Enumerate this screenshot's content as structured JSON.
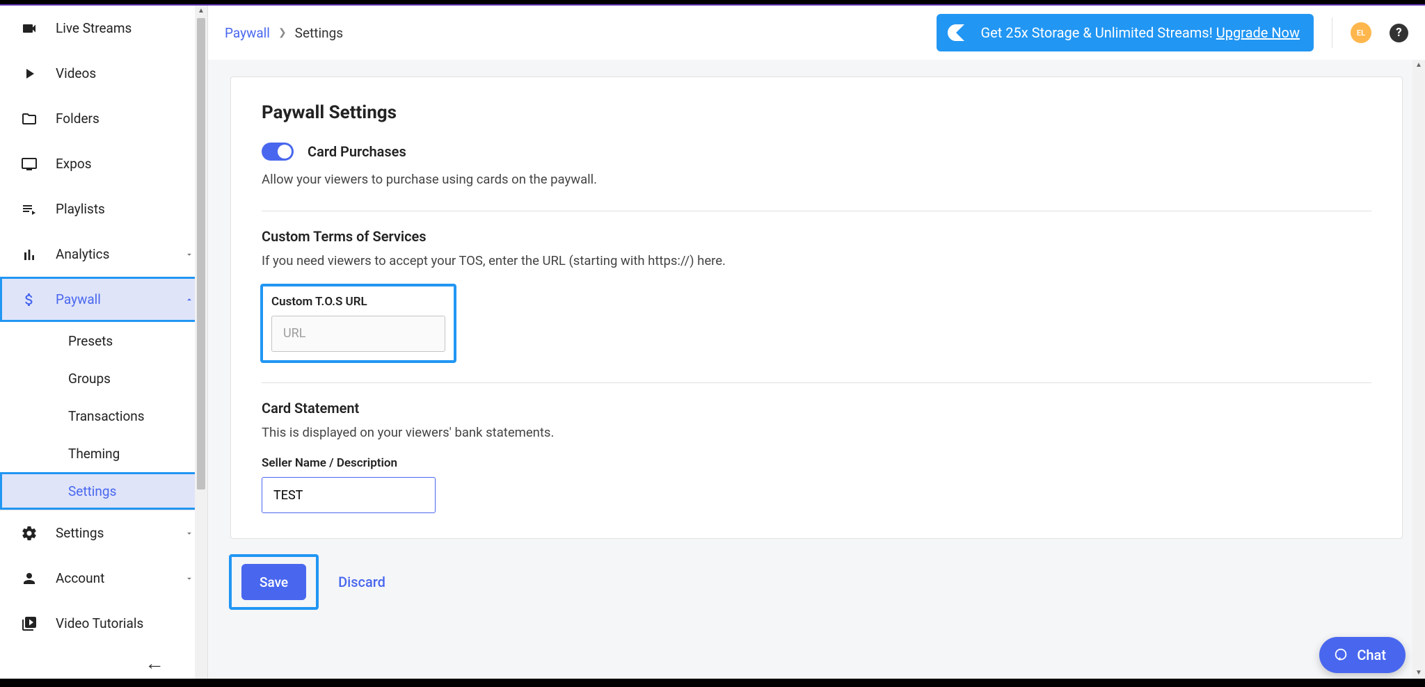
{
  "sidebar": {
    "items": {
      "liveStreams": "Live Streams",
      "videos": "Videos",
      "folders": "Folders",
      "expos": "Expos",
      "playlists": "Playlists",
      "analytics": "Analytics",
      "paywall": "Paywall",
      "settings": "Settings",
      "account": "Account",
      "videoTutorials": "Video Tutorials"
    },
    "paywallSub": {
      "presets": "Presets",
      "groups": "Groups",
      "transactions": "Transactions",
      "theming": "Theming",
      "settings": "Settings"
    }
  },
  "breadcrumb": {
    "parent": "Paywall",
    "current": "Settings"
  },
  "banner": {
    "text": "Get 25x Storage & Unlimited Streams! ",
    "cta": "Upgrade Now"
  },
  "avatar": "EL",
  "page": {
    "title": "Paywall Settings",
    "cardPurchases": {
      "label": "Card Purchases",
      "desc": "Allow your viewers to purchase using cards on the paywall."
    },
    "tos": {
      "title": "Custom Terms of Services",
      "desc": "If you need viewers to accept your TOS, enter the URL (starting with https://) here.",
      "fieldLabel": "Custom T.O.S URL",
      "placeholder": "URL"
    },
    "cardStatement": {
      "title": "Card Statement",
      "desc": "This is displayed on your viewers' bank statements.",
      "fieldLabel": "Seller Name / Description",
      "value": "TEST"
    },
    "actions": {
      "save": "Save",
      "discard": "Discard"
    }
  },
  "chat": "Chat"
}
